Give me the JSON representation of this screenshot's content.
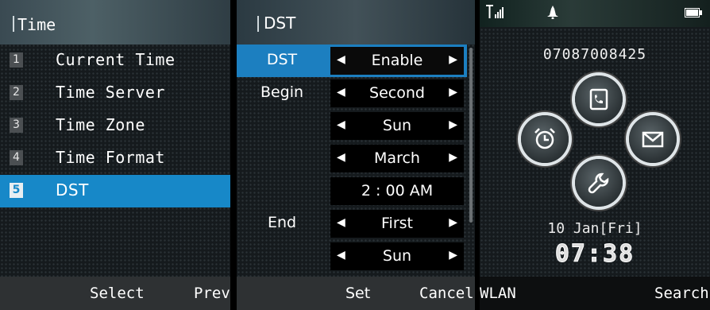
{
  "screen1": {
    "title": "Time",
    "items": [
      {
        "num": "1",
        "label": "Current Time"
      },
      {
        "num": "2",
        "label": "Time Server"
      },
      {
        "num": "3",
        "label": "Time Zone"
      },
      {
        "num": "4",
        "label": "Time Format"
      },
      {
        "num": "5",
        "label": "DST"
      }
    ],
    "selected_index": 4,
    "softkeys": {
      "center": "Select",
      "right": "Prev"
    }
  },
  "screen2": {
    "title": "DST",
    "rows": [
      {
        "label": "DST",
        "value": "Enable"
      },
      {
        "label": "Begin",
        "value": "Second"
      },
      {
        "label": "",
        "value": "Sun"
      },
      {
        "label": "",
        "value": "March"
      },
      {
        "label": "",
        "value": "2 : 00 AM"
      },
      {
        "label": "End",
        "value": "First"
      },
      {
        "label": "",
        "value": "Sun"
      }
    ],
    "arrows": {
      "left": "◀",
      "right": "▶"
    },
    "softkeys": {
      "left": "Set",
      "right": "Cancel"
    }
  },
  "screen3": {
    "phone_number": "07087008425",
    "date": "10 Jan[Fri]",
    "time": "07:38",
    "softkeys": {
      "left": "WLAN",
      "right": "Search"
    },
    "icons": [
      "signal-icon",
      "bell-icon",
      "battery-icon",
      "call-log-icon",
      "alarm-icon",
      "message-icon",
      "settings-icon"
    ]
  },
  "colors": {
    "accent": "#1788c8",
    "softkey_bar": "#2e3133"
  }
}
